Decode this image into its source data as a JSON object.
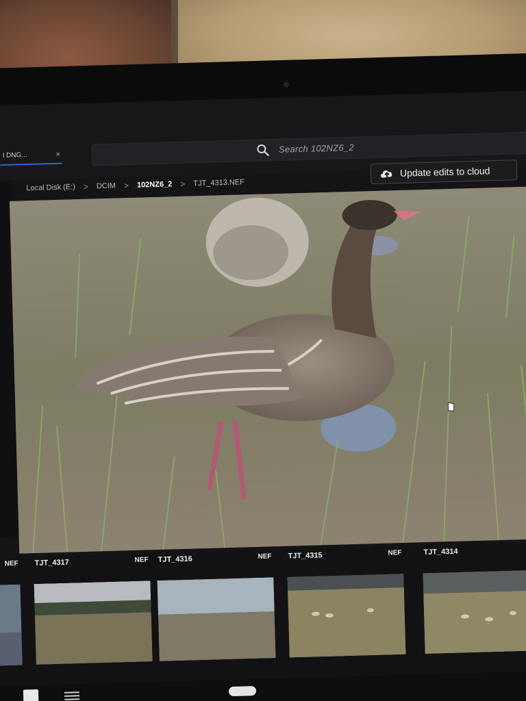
{
  "tab": {
    "label": "l DNG...",
    "close": "×"
  },
  "search": {
    "placeholder": "Search 102NZ6_2",
    "icon": "search-icon"
  },
  "breadcrumb": {
    "items": [
      "Local Disk (E:)",
      "DCIM",
      "102NZ6_2",
      "TJT_4313.NEF"
    ],
    "separator": ">"
  },
  "cloud_button": {
    "label": "Update edits to cloud",
    "icon": "cloud-upload-icon"
  },
  "filmstrip": {
    "items": [
      {
        "name": "",
        "format": "NEF"
      },
      {
        "name": "TJT_4317",
        "format": "NEF"
      },
      {
        "name": "TJT_4316",
        "format": "NEF"
      },
      {
        "name": "TJT_4315",
        "format": "NEF"
      },
      {
        "name": "TJT_4314",
        "format": "N"
      }
    ]
  },
  "colors": {
    "accent": "#2e63c9",
    "background": "#141416"
  }
}
